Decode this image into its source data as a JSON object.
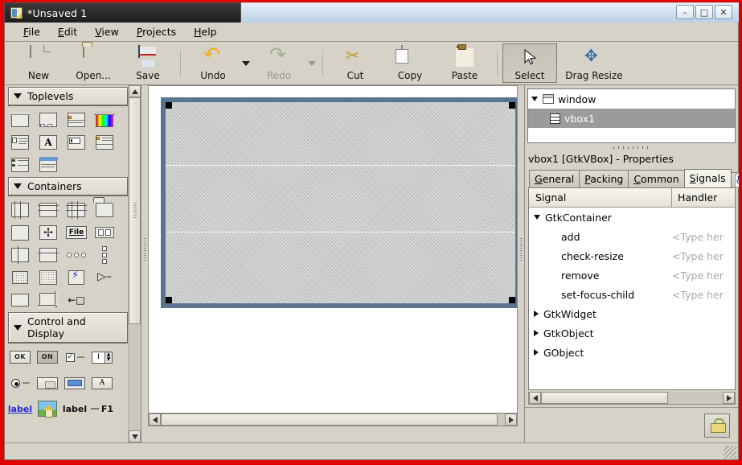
{
  "window": {
    "title": "*Unsaved 1",
    "icon": "glade-app-icon",
    "controls": [
      {
        "name": "minimize-button",
        "glyph": "–"
      },
      {
        "name": "maximize-button",
        "glyph": "□"
      },
      {
        "name": "close-button",
        "glyph": "✕"
      }
    ]
  },
  "menubar": {
    "items": [
      {
        "label": "File",
        "mnemonic": "F"
      },
      {
        "label": "Edit",
        "mnemonic": "E"
      },
      {
        "label": "View",
        "mnemonic": "V"
      },
      {
        "label": "Projects",
        "mnemonic": "P"
      },
      {
        "label": "Help",
        "mnemonic": "H"
      }
    ]
  },
  "toolbar": {
    "new_label": "New",
    "open_label": "Open...",
    "save_label": "Save",
    "undo_label": "Undo",
    "redo_label": "Redo",
    "cut_label": "Cut",
    "copy_label": "Copy",
    "paste_label": "Paste",
    "select_label": "Select",
    "drag_resize_label": "Drag Resize",
    "redo_disabled": true,
    "select_active": true
  },
  "palette": {
    "groups": [
      {
        "title": "Toplevels",
        "expanded": true,
        "items": [
          "window-widget",
          "dialog-widget",
          "message-dialog-widget",
          "color-selection-dialog-widget",
          "about-dialog-widget",
          "font-selection-dialog-widget",
          "input-dialog-widget",
          "file-chooser-dialog-widget",
          "assistant-widget",
          "offscreen-window-widget"
        ]
      },
      {
        "title": "Containers",
        "expanded": true,
        "items": [
          "hbox-widget",
          "vbox-widget",
          "table-widget",
          "notebook-widget",
          "frame-widget",
          "alignment-widget",
          "file-chooser-widget",
          "hbutton-box-widget",
          "hpaned-widget",
          "vpaned-widget",
          "hbutton-row-widget",
          "vbutton-column-widget",
          "fixed-widget",
          "layout-widget",
          "event-box-widget",
          "expander-widget",
          "aspect-frame-widget",
          "scrolled-window-widget",
          "viewport-widget"
        ]
      },
      {
        "title": "Control and Display",
        "expanded": true,
        "items": [
          {
            "type": "button",
            "label": "OK"
          },
          {
            "type": "toggle",
            "label": "ON"
          },
          {
            "type": "checkbutton",
            "label": ""
          },
          {
            "type": "spinbutton",
            "label": ""
          },
          {
            "type": "radiobutton",
            "label": ""
          },
          {
            "type": "combobox",
            "label": ""
          },
          {
            "type": "entry",
            "label": ""
          },
          {
            "type": "textview",
            "label": "A"
          },
          {
            "type": "linkbutton",
            "label": "label"
          },
          {
            "type": "image",
            "label": ""
          },
          {
            "type": "label",
            "label": "label"
          },
          {
            "type": "accel-label",
            "label": "F1"
          }
        ]
      }
    ]
  },
  "canvas": {
    "widget_name": "vbox1",
    "sections": 3,
    "selected": true
  },
  "inspector": {
    "tree": [
      {
        "label": "window",
        "icon": "window-icon",
        "depth": 0,
        "expanded": true,
        "selected": false
      },
      {
        "label": "vbox1",
        "icon": "vbox-icon",
        "depth": 1,
        "expanded": false,
        "selected": true
      }
    ],
    "properties_title": "vbox1 [GtkVBox] - Properties",
    "tabs": [
      {
        "label": "General",
        "mnemonic": "G",
        "active": false
      },
      {
        "label": "Packing",
        "mnemonic": "P",
        "active": false
      },
      {
        "label": "Common",
        "mnemonic": "C",
        "active": false
      },
      {
        "label": "Signals",
        "mnemonic": "S",
        "active": true
      }
    ],
    "accessibility_tab": "accessibility-icon",
    "signals": {
      "columns": [
        "Signal",
        "Handler"
      ],
      "handler_placeholder": "<Type her",
      "rows": [
        {
          "label": "GtkContainer",
          "type": "group",
          "expanded": true,
          "handler": ""
        },
        {
          "label": "add",
          "type": "signal",
          "handler": "<Type her"
        },
        {
          "label": "check-resize",
          "type": "signal",
          "handler": "<Type her"
        },
        {
          "label": "remove",
          "type": "signal",
          "handler": "<Type her"
        },
        {
          "label": "set-focus-child",
          "type": "signal",
          "handler": "<Type her"
        },
        {
          "label": "GtkWidget",
          "type": "group",
          "expanded": false,
          "handler": ""
        },
        {
          "label": "GtkObject",
          "type": "group",
          "expanded": false,
          "handler": ""
        },
        {
          "label": "GObject",
          "type": "group",
          "expanded": false,
          "handler": ""
        }
      ]
    },
    "lock_button": "lock-icon"
  },
  "colors": {
    "chrome": "#d6d2c8",
    "selection_border": "#5a768f",
    "tree_selection": "#9b9b9b",
    "accent_red": "#e00000"
  }
}
